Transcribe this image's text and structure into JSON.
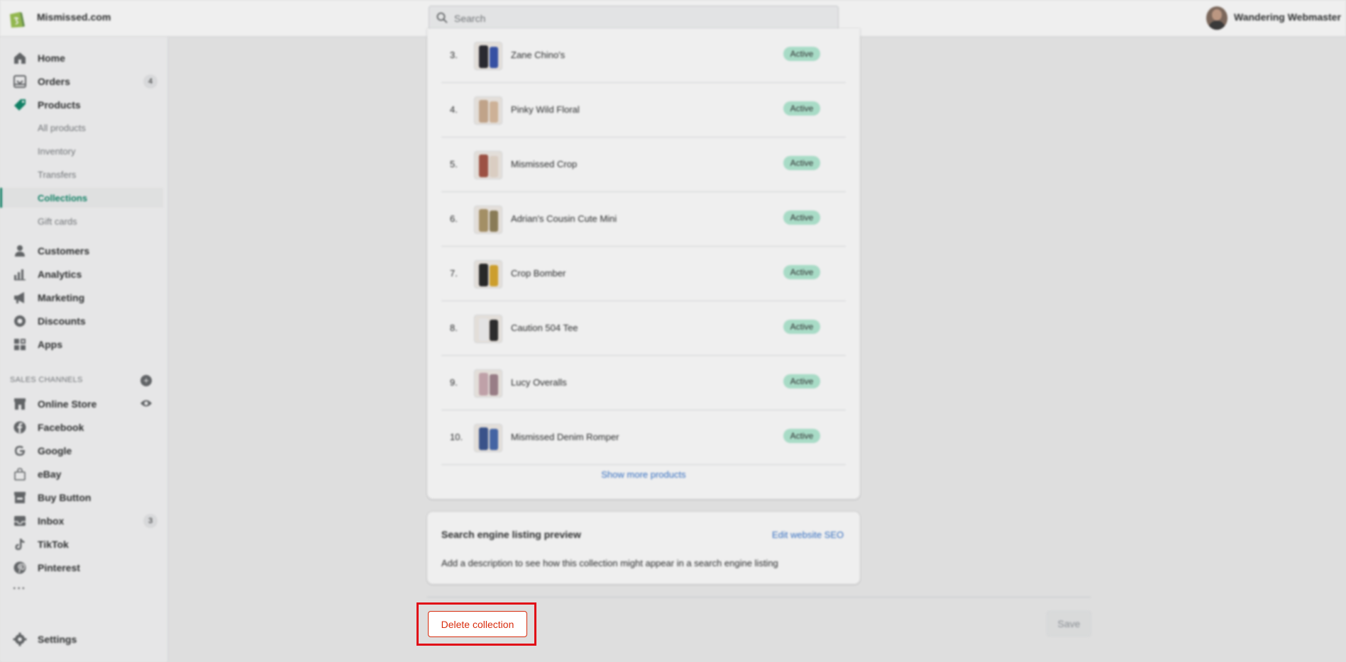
{
  "topbar": {
    "store_name": "Mismissed.com",
    "search_placeholder": "Search",
    "user_name": "Wandering Webmaster"
  },
  "sidebar": {
    "items": [
      {
        "label": "Home",
        "icon": "home-icon"
      },
      {
        "label": "Orders",
        "icon": "orders-icon",
        "badge": "4"
      },
      {
        "label": "Products",
        "icon": "tag-icon"
      },
      {
        "label": "Customers",
        "icon": "person-icon"
      },
      {
        "label": "Analytics",
        "icon": "bar-chart-icon"
      },
      {
        "label": "Marketing",
        "icon": "megaphone-icon"
      },
      {
        "label": "Discounts",
        "icon": "discount-icon"
      },
      {
        "label": "Apps",
        "icon": "apps-icon"
      }
    ],
    "product_subitems": [
      "All products",
      "Inventory",
      "Transfers",
      "Collections",
      "Gift cards"
    ],
    "active_subitem": "Collections",
    "sales_channels_heading": "SALES CHANNELS",
    "channels": [
      {
        "label": "Online Store",
        "icon": "store-icon"
      },
      {
        "label": "Facebook",
        "icon": "facebook-icon"
      },
      {
        "label": "Google",
        "icon": "google-icon"
      },
      {
        "label": "eBay",
        "icon": "bag-icon"
      },
      {
        "label": "Buy Button",
        "icon": "buy-button-icon"
      },
      {
        "label": "Inbox",
        "icon": "inbox-icon",
        "badge": "3"
      },
      {
        "label": "TikTok",
        "icon": "tiktok-icon"
      },
      {
        "label": "Pinterest",
        "icon": "pinterest-icon"
      }
    ],
    "more": "···",
    "settings_label": "Settings"
  },
  "products": {
    "rows": [
      {
        "num": "3.",
        "title": "Zane Chino's",
        "status": "Active",
        "c1": "#1c1c24",
        "c2": "#2b4aa8"
      },
      {
        "num": "4.",
        "title": "Pinky Wild Floral",
        "status": "Active",
        "c1": "#c9a88a",
        "c2": "#d8b99a"
      },
      {
        "num": "5.",
        "title": "Mismissed Crop",
        "status": "Active",
        "c1": "#a04a3a",
        "c2": "#e7d8cc"
      },
      {
        "num": "6.",
        "title": "Adrian's Cousin Cute Mini",
        "status": "Active",
        "c1": "#a89060",
        "c2": "#8a7a50"
      },
      {
        "num": "7.",
        "title": "Crop Bomber",
        "status": "Active",
        "c1": "#1a1a1a",
        "c2": "#d7a21f"
      },
      {
        "num": "8.",
        "title": "Caution 504 Tee",
        "status": "Active",
        "c1": "#f2f2f2",
        "c2": "#1f1f1f"
      },
      {
        "num": "9.",
        "title": "Lucy Overalls",
        "status": "Active",
        "c1": "#c8a6ae",
        "c2": "#9b7c86"
      },
      {
        "num": "10.",
        "title": "Mismissed Denim Romper",
        "status": "Active",
        "c1": "#2e4b8a",
        "c2": "#3a5fa8"
      }
    ],
    "show_more": "Show more products"
  },
  "seo": {
    "title": "Search engine listing preview",
    "edit_link": "Edit website SEO",
    "description": "Add a description to see how this collection might appear in a search engine listing"
  },
  "actions": {
    "delete_label": "Delete collection",
    "save_label": "Save"
  },
  "colors": {
    "accent_green": "#008060",
    "highlight_red": "#e10c17",
    "critical": "#d82c0d"
  }
}
